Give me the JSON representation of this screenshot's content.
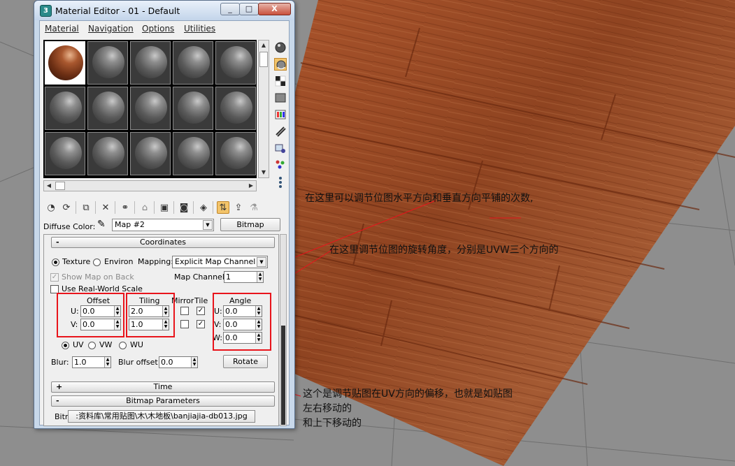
{
  "window": {
    "title": "Material Editor - 01 - Default",
    "minimize": "_",
    "maximize": "□",
    "close": "X"
  },
  "menu": [
    "Material",
    "Navigation",
    "Options",
    "Utilities"
  ],
  "slots": {
    "rows": 3,
    "cols": 5,
    "active_index": 0
  },
  "side_tools": [
    "sample-type-icon",
    "backlight-icon",
    "background-icon",
    "uv-tiling-icon",
    "video-color-check-icon",
    "make-preview-icon",
    "options-icon",
    "select-by-material-icon",
    "material-navigator-icon"
  ],
  "toolbar_icons": [
    "get-material-icon",
    "put-to-scene-icon",
    "assign-to-selection-icon",
    "reset-map-icon",
    "make-unique-icon",
    "put-to-library-icon",
    "material-effects-channel-icon",
    "show-map-in-viewport-icon",
    "show-end-result-icon",
    "go-to-parent-icon",
    "go-forward-to-sibling-icon"
  ],
  "diffuse": {
    "label": "Diffuse Color:",
    "map_name": "Map #2",
    "map_type": "Bitmap"
  },
  "coordinates": {
    "header": "Coordinates",
    "collapse_sign": "-",
    "texture_label": "Texture",
    "environ_label": "Environ",
    "mapping_label": "Mapping:",
    "mapping_value": "Explicit Map Channel",
    "show_map_on_back": "Show Map on Back",
    "use_real_world_scale": "Use Real-World Scale",
    "map_channel_label": "Map Channel:",
    "map_channel_value": "1",
    "offset_label": "Offset",
    "tiling_label": "Tiling",
    "mirror_label": "Mirror",
    "tile_label": "Tile",
    "angle_label": "Angle",
    "u_label": "U:",
    "v_label": "V:",
    "w_label": "W:",
    "offset_u": "0.0",
    "offset_v": "0.0",
    "tiling_u": "2.0",
    "tiling_v": "1.0",
    "angle_u": "0.0",
    "angle_v": "0.0",
    "angle_w": "0.0",
    "uv_label": "UV",
    "vw_label": "VW",
    "wu_label": "WU",
    "blur_label": "Blur:",
    "blur_value": "1.0",
    "blur_offset_label": "Blur offset:",
    "blur_offset_value": "0.0",
    "rotate_label": "Rotate"
  },
  "time_rollout": {
    "sign": "+",
    "header": "Time"
  },
  "bitmap_rollout": {
    "sign": "-",
    "header": "Bitmap Parameters",
    "bitmap_label": "Bitmap:",
    "bitmap_path": ":资料库\\常用贴图\\木\\木地板\\banjiajia-db013.jpg"
  },
  "annotations": {
    "tiling": "在这里可以调节位图水平方向和垂直方向平铺的次数,",
    "angle": "在这里调节位图的旋转角度，分别是UVW三个方向的",
    "offset_line1": "这个是调节贴图在UV方向的偏移，也就是如贴图",
    "offset_line2": "左右移动的",
    "offset_line3": "和上下移动的"
  },
  "colors": {
    "highlight": "#e8141b",
    "wood": "#9c4a25",
    "viewport_bg": "#8e8e8e"
  }
}
